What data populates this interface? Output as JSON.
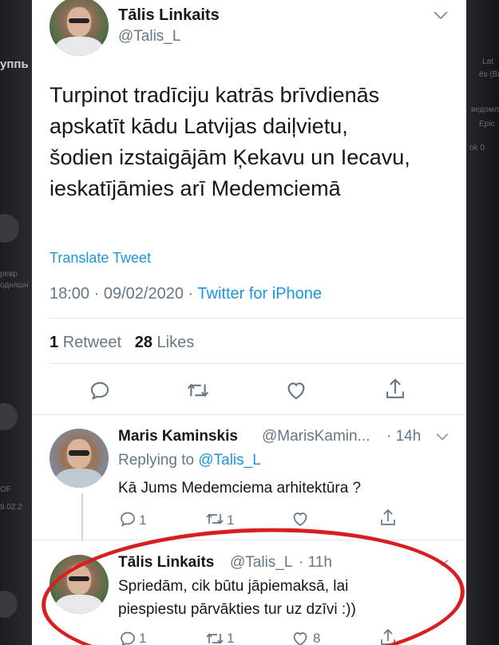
{
  "tweet": {
    "author_name": "Tālis Linkaits",
    "author_handle": "@Talis_L",
    "text_lines": [
      "Turpinot tradīciju katrās brīvdienās",
      "apskatīt kādu Latvijas  daiļvietu,",
      "šodien izstaigājām Ķekavu un Iecavu,",
      "ieskatījāmies arī Medemciemā"
    ],
    "translate_label": "Translate Tweet",
    "time": "18:00",
    "date": "09/02/2020",
    "separator": "·",
    "source": "Twitter for iPhone",
    "retweet_count": "1",
    "retweet_label": "Retweet",
    "like_count": "28",
    "like_label": "Likes"
  },
  "actions_icons": [
    "reply-icon",
    "retweet-icon",
    "like-icon",
    "share-icon"
  ],
  "replies": [
    {
      "name": "Maris Kaminskis",
      "handle": "@MarisKamin...",
      "time": "· 14h",
      "replying_prefix": "Replying to",
      "replying_to": "@Talis_L",
      "text_lines": [
        "Kā Jums Medemciema arhitektūra ?"
      ],
      "reply_count": "1",
      "retweet_count": "1",
      "like_count": ""
    },
    {
      "name": "Tālis Linkaits",
      "handle": "@Talis_L",
      "time": "· 11h",
      "text_lines": [
        "Spriedām, cik būtu jāpiemaksā, lai",
        "piespiestu pārvākties tur uz dzīvi :))"
      ],
      "reply_count": "1",
      "retweet_count": "1",
      "like_count": "8"
    }
  ],
  "background": {
    "left_fragments": [
      "уппь",
      "ревр",
      "одняшн",
      "OF",
      "9.02.2"
    ],
    "right_fragments": [
      "Lat",
      "ēs (Bri",
      "ведомл",
      "Epic",
      "ok 0"
    ]
  },
  "colors": {
    "accent": "#1b95e0",
    "text": "#14171a",
    "secondary": "#657786",
    "annotation": "#d81e1e"
  }
}
